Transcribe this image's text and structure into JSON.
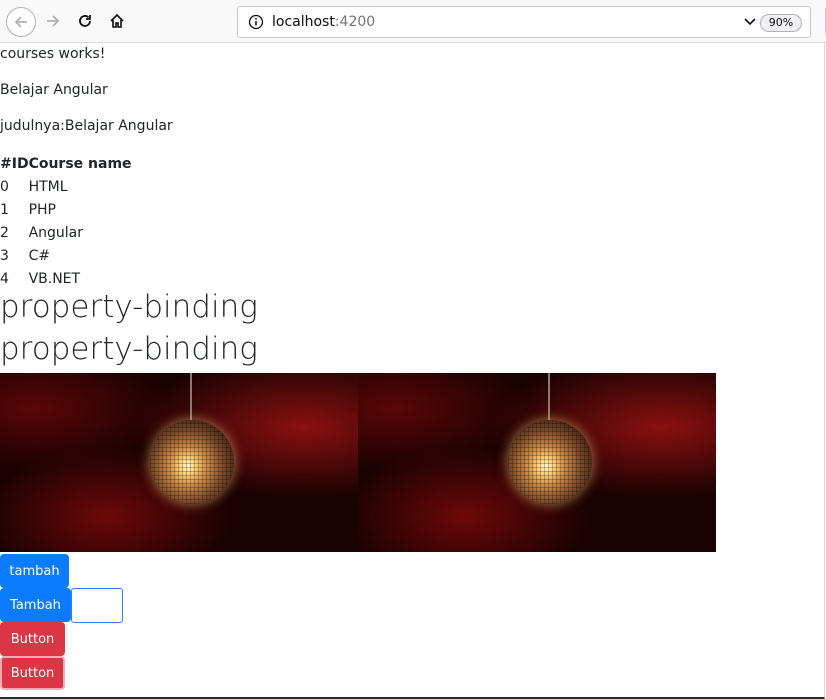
{
  "browser": {
    "url_host": "localhost",
    "url_port": ":4200",
    "zoom": "90%"
  },
  "page": {
    "status_text": "courses works!",
    "title_text": "Belajar Angular",
    "judul_text": "judulnya:Belajar Angular",
    "table": {
      "headers": [
        "#ID",
        "Course name"
      ],
      "rows": [
        {
          "id": "0",
          "name": "HTML"
        },
        {
          "id": "1",
          "name": "PHP"
        },
        {
          "id": "2",
          "name": "Angular"
        },
        {
          "id": "3",
          "name": "C#"
        },
        {
          "id": "4",
          "name": "VB.NET"
        }
      ]
    },
    "heading_1": "property-binding",
    "heading_2": "property-binding",
    "buttons": {
      "tambah_1": "tambah",
      "tambah_2": "Tambah",
      "button_1": "Button",
      "button_2": "Button"
    },
    "colors": {
      "primary": "#0b7bff",
      "danger": "#dc3545"
    }
  }
}
